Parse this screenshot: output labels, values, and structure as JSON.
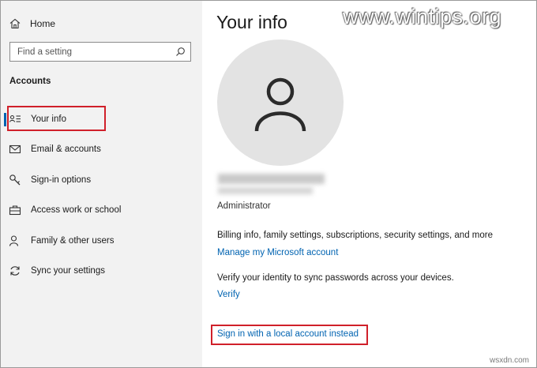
{
  "sidebar": {
    "home_label": "Home",
    "search_placeholder": "Find a setting",
    "section_title": "Accounts",
    "items": [
      {
        "label": "Your info",
        "icon": "person-card-icon",
        "active": true
      },
      {
        "label": "Email & accounts",
        "icon": "mail-icon"
      },
      {
        "label": "Sign-in options",
        "icon": "key-icon"
      },
      {
        "label": "Access work or school",
        "icon": "briefcase-icon"
      },
      {
        "label": "Family & other users",
        "icon": "person-add-icon"
      },
      {
        "label": "Sync your settings",
        "icon": "sync-icon"
      }
    ]
  },
  "main": {
    "title": "Your info",
    "role": "Administrator",
    "billing_text": "Billing info, family settings, subscriptions, security settings, and more",
    "manage_link": "Manage my Microsoft account",
    "verify_text": "Verify your identity to sync passwords across your devices.",
    "verify_link": "Verify",
    "local_account_link": "Sign in with a local account instead"
  },
  "watermark": "www.wintips.org",
  "credit": "wsxdn.com",
  "colors": {
    "accent": "#0063b1",
    "highlight": "#d0202a",
    "sidebar_bg": "#f2f2f2",
    "avatar_bg": "#e3e3e3"
  }
}
